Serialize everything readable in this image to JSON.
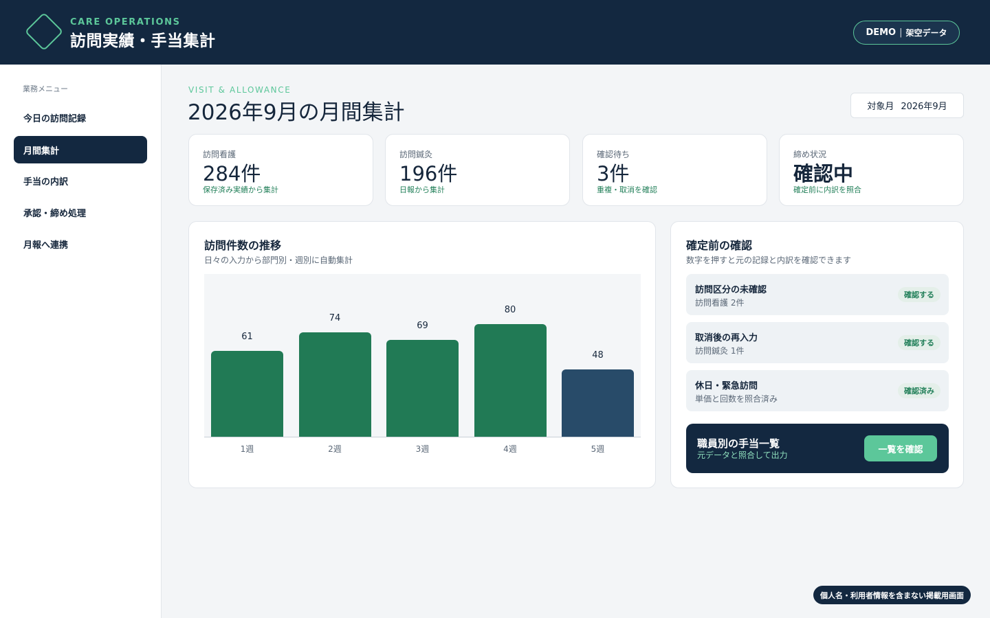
{
  "header": {
    "brand_sub": "CARE OPERATIONS",
    "brand_title": "訪問実績・手当集計",
    "badge_strong": "DEMO",
    "badge_sep": "|",
    "badge_rest": "架空データ",
    "logo_icon": "diamond-logo-icon"
  },
  "sidebar": {
    "title": "業務メニュー",
    "items": [
      {
        "label": "今日の訪問記録",
        "active": false
      },
      {
        "label": "月間集計",
        "active": true
      },
      {
        "label": "手当の内訳",
        "active": false
      },
      {
        "label": "承認・締め処理",
        "active": false
      },
      {
        "label": "月報へ連携",
        "active": false
      }
    ]
  },
  "page": {
    "eyebrow": "VISIT & ALLOWANCE",
    "title": "2026年9月の月間集計",
    "month_label": "対象月",
    "month_value": "2026年9月"
  },
  "stats": [
    {
      "label": "訪問看護",
      "value": "284件",
      "note": "保存済み実績から集計"
    },
    {
      "label": "訪問鍼灸",
      "value": "196件",
      "note": "日報から集計"
    },
    {
      "label": "確認待ち",
      "value": "3件",
      "note": "重複・取消を確認"
    },
    {
      "label": "締め状況",
      "value": "確認中",
      "note": "確定前に内訳を照合"
    }
  ],
  "chart_panel": {
    "title": "訪問件数の推移",
    "subtitle": "日々の入力から部門別・週別に自動集計"
  },
  "chart_data": {
    "type": "bar",
    "categories": [
      "1週",
      "2週",
      "3週",
      "4週",
      "5週"
    ],
    "values": [
      61,
      74,
      69,
      80,
      48
    ],
    "ylim": [
      0,
      100
    ],
    "colors": [
      "#217a55",
      "#217a55",
      "#217a55",
      "#217a55",
      "#284b69"
    ],
    "grid": false,
    "title": "",
    "xlabel": "",
    "ylabel": ""
  },
  "check_panel": {
    "title": "確定前の確認",
    "subtitle": "数字を押すと元の記録と内訳を確認できます",
    "items": [
      {
        "title": "訪問区分の未確認",
        "sub": "訪問看護 2件",
        "action": "確認する"
      },
      {
        "title": "取消後の再入力",
        "sub": "訪問鍼灸 1件",
        "action": "確認する"
      },
      {
        "title": "休日・緊急訪問",
        "sub": "単価と回数を照合済み",
        "action": "確認済み"
      }
    ],
    "cta": {
      "title": "職員別の手当一覧",
      "sub": "元データと照合して出力",
      "button": "一覧を確認"
    }
  },
  "footer_badge": "個人名・利用者情報を含まない掲載用画面",
  "colors": {
    "navy": "#132840",
    "accent": "#5cc79a",
    "bar_green": "#217a55",
    "bar_blue": "#284b69"
  }
}
